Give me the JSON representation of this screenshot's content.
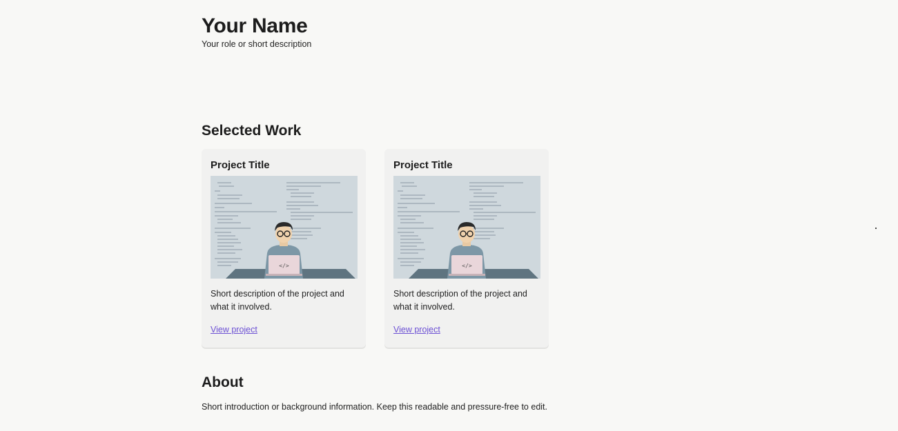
{
  "header": {
    "name": "Your Name",
    "role": "Your role or short description"
  },
  "work": {
    "title": "Selected Work",
    "projects": [
      {
        "title": "Project Title",
        "image_icon": "developer-illustration",
        "laptop_symbol": "</>",
        "description": "Short description of the project and what it involved.",
        "link_label": "View project"
      },
      {
        "title": "Project Title",
        "image_icon": "developer-illustration",
        "laptop_symbol": "</>",
        "description": "Short description of the project and what it involved.",
        "link_label": "View project"
      }
    ]
  },
  "about": {
    "title": "About",
    "text": "Short introduction or background information. Keep this readable and pressure-free to edit."
  },
  "colors": {
    "background": "#f8f8f6",
    "card": "#f1f1f0",
    "link": "#6b4fd4",
    "text": "#1c1c1c"
  }
}
